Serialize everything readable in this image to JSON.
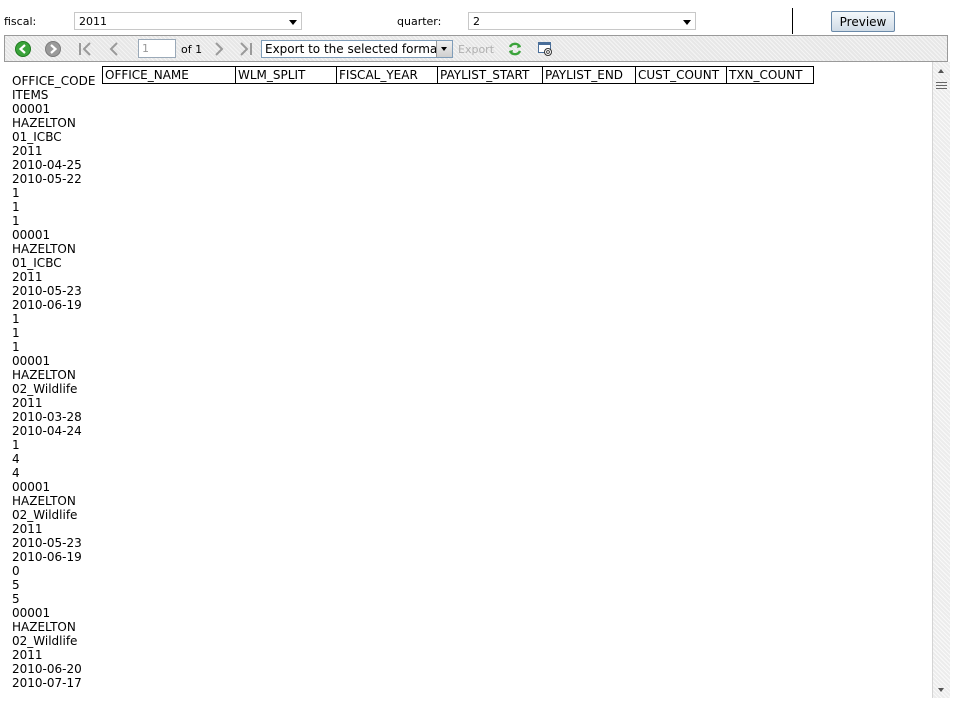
{
  "params": {
    "fiscal_label": "fiscal:",
    "fiscal_value": "2011",
    "quarter_label": "quarter:",
    "quarter_value": "2",
    "preview_label": "Preview"
  },
  "toolbar": {
    "page_value": "1",
    "page_of": "of 1",
    "export_format": "Export to the selected format",
    "export_label": "Export"
  },
  "report": {
    "left_lines": [
      "OFFICE_CODE",
      "ITEMS",
      "00001",
      "HAZELTON",
      "01_ICBC",
      "2011",
      "2010-04-25",
      "2010-05-22",
      "1",
      "1",
      "1",
      "00001",
      "HAZELTON",
      "01_ICBC",
      "2011",
      "2010-05-23",
      "2010-06-19",
      "1",
      "1",
      "1",
      "00001",
      "HAZELTON",
      "02_Wildlife",
      "2011",
      "2010-03-28",
      "2010-04-24",
      "1",
      "4",
      "4",
      "00001",
      "HAZELTON",
      "02_Wildlife",
      "2011",
      "2010-05-23",
      "2010-06-19",
      "0",
      "5",
      "5",
      "00001",
      "HAZELTON",
      "02_Wildlife",
      "2011",
      "2010-06-20",
      "2010-07-17"
    ],
    "columns": [
      "OFFICE_NAME",
      "WLM_SPLIT",
      "FISCAL_YEAR",
      "PAYLIST_START",
      "PAYLIST_END",
      "CUST_COUNT",
      "TXN_COUNT"
    ]
  },
  "colors": {
    "green_nav": "#3aa33a",
    "gray_nav": "#9a9a9a",
    "toolbar_bg": "#e7e7e7"
  }
}
